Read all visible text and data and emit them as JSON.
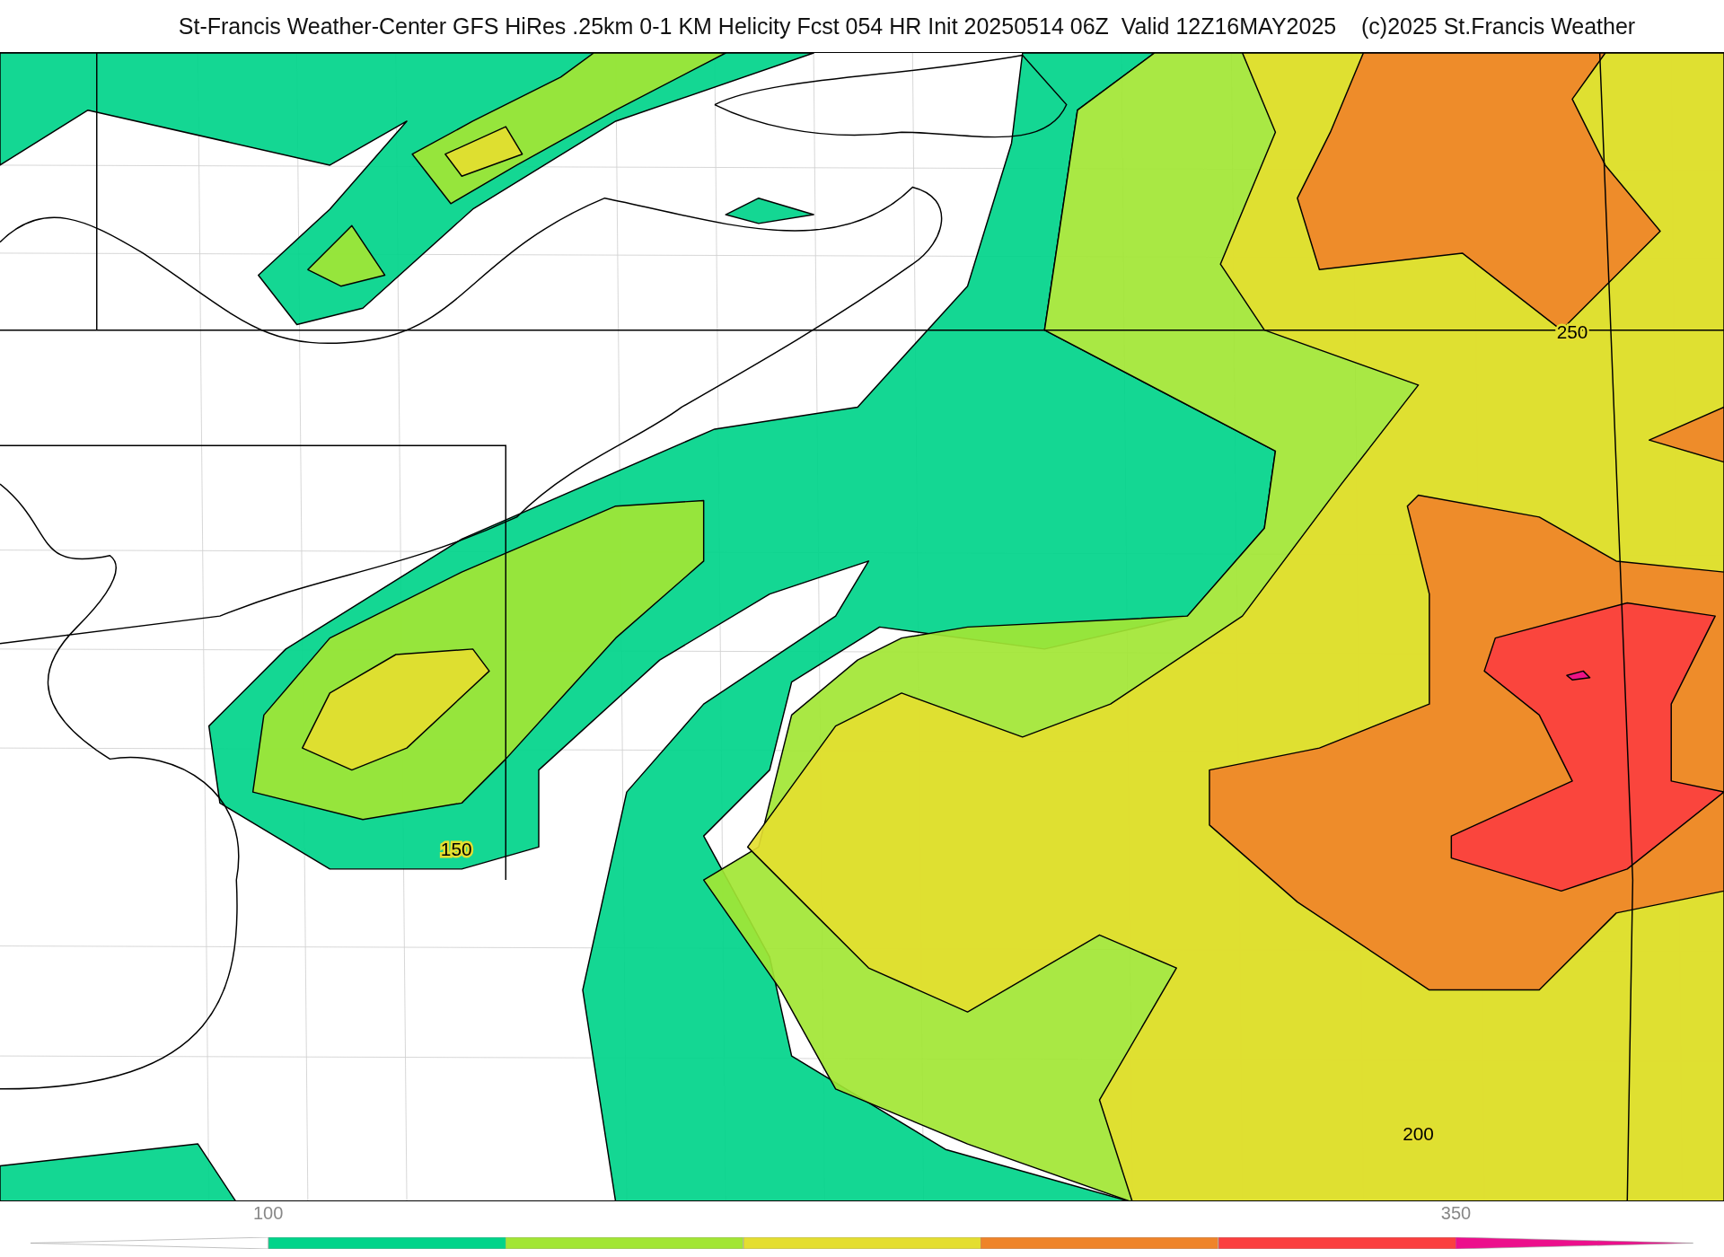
{
  "title": "St-Francis Weather-Center GFS HiRes .25km 0-1 KM Helicity Fcst 054 HR Init 20250514 06Z  Valid 12Z16MAY2025    (c)2025 St.Francis Weather",
  "map": {
    "contour_labels": [
      {
        "text": "150",
        "kind": "c150"
      },
      {
        "text": "250",
        "kind": "c250"
      },
      {
        "text": "200",
        "kind": "c200"
      }
    ]
  },
  "colorbar": {
    "segments": [
      {
        "kind": "under",
        "color": "#ffffff"
      },
      {
        "kind": "bin",
        "color": "#00d48a",
        "tick_label": "100"
      },
      {
        "kind": "bin",
        "color": "#a2e634"
      },
      {
        "kind": "bin",
        "color": "#e4de30"
      },
      {
        "kind": "bin",
        "color": "#ef8429"
      },
      {
        "kind": "bin",
        "color": "#fb3f3f"
      },
      {
        "kind": "over",
        "color": "#ec0f8c",
        "tick_label": "350"
      }
    ]
  }
}
